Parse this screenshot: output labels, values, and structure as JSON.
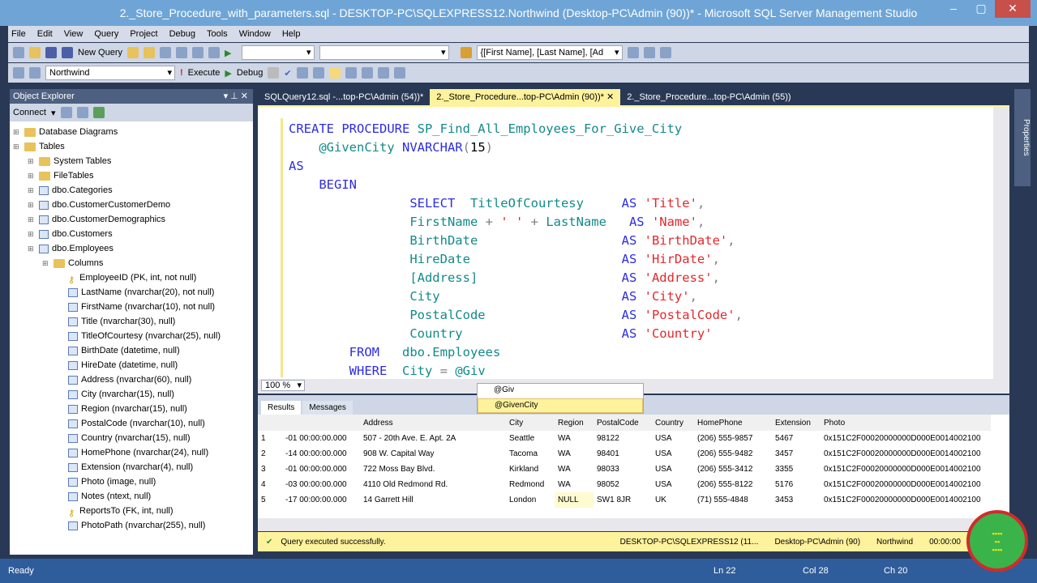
{
  "title": "2._Store_Procedure_with_parameters.sql - DESKTOP-PC\\SQLEXPRESS12.Northwind (Desktop-PC\\Admin (90))* - Microsoft SQL Server Management Studio",
  "menu": [
    "File",
    "Edit",
    "View",
    "Query",
    "Project",
    "Debug",
    "Tools",
    "Window",
    "Help"
  ],
  "toolbar": {
    "new_query": "New Query",
    "database": "Northwind",
    "execute": "Execute",
    "debug": "Debug",
    "template_combo": "{[First Name], [Last Name], [Ad"
  },
  "object_explorer": {
    "title": "Object Explorer",
    "connect": "Connect",
    "items": [
      {
        "label": "Database Diagrams",
        "level": 0,
        "icon": "folder"
      },
      {
        "label": "Tables",
        "level": 0,
        "icon": "folder"
      },
      {
        "label": "System Tables",
        "level": 1,
        "icon": "folder"
      },
      {
        "label": "FileTables",
        "level": 1,
        "icon": "folder"
      },
      {
        "label": "dbo.Categories",
        "level": 1,
        "icon": "table"
      },
      {
        "label": "dbo.CustomerCustomerDemo",
        "level": 1,
        "icon": "table"
      },
      {
        "label": "dbo.CustomerDemographics",
        "level": 1,
        "icon": "table"
      },
      {
        "label": "dbo.Customers",
        "level": 1,
        "icon": "table"
      },
      {
        "label": "dbo.Employees",
        "level": 1,
        "icon": "table"
      },
      {
        "label": "Columns",
        "level": 2,
        "icon": "folder"
      },
      {
        "label": "EmployeeID (PK, int, not null)",
        "level": 3,
        "icon": "key"
      },
      {
        "label": "LastName (nvarchar(20), not null)",
        "level": 3,
        "icon": "column"
      },
      {
        "label": "FirstName (nvarchar(10), not null)",
        "level": 3,
        "icon": "column"
      },
      {
        "label": "Title (nvarchar(30), null)",
        "level": 3,
        "icon": "column"
      },
      {
        "label": "TitleOfCourtesy (nvarchar(25), null)",
        "level": 3,
        "icon": "column"
      },
      {
        "label": "BirthDate (datetime, null)",
        "level": 3,
        "icon": "column"
      },
      {
        "label": "HireDate (datetime, null)",
        "level": 3,
        "icon": "column"
      },
      {
        "label": "Address (nvarchar(60), null)",
        "level": 3,
        "icon": "column"
      },
      {
        "label": "City (nvarchar(15), null)",
        "level": 3,
        "icon": "column"
      },
      {
        "label": "Region (nvarchar(15), null)",
        "level": 3,
        "icon": "column"
      },
      {
        "label": "PostalCode (nvarchar(10), null)",
        "level": 3,
        "icon": "column"
      },
      {
        "label": "Country (nvarchar(15), null)",
        "level": 3,
        "icon": "column"
      },
      {
        "label": "HomePhone (nvarchar(24), null)",
        "level": 3,
        "icon": "column"
      },
      {
        "label": "Extension (nvarchar(4), null)",
        "level": 3,
        "icon": "column"
      },
      {
        "label": "Photo (image, null)",
        "level": 3,
        "icon": "column"
      },
      {
        "label": "Notes (ntext, null)",
        "level": 3,
        "icon": "column"
      },
      {
        "label": "ReportsTo (FK, int, null)",
        "level": 3,
        "icon": "key"
      },
      {
        "label": "PhotoPath (nvarchar(255), null)",
        "level": 3,
        "icon": "column"
      }
    ]
  },
  "tabs": [
    {
      "label": "SQLQuery12.sql -...top-PC\\Admin (54))*",
      "active": false
    },
    {
      "label": "2._Store_Procedure...top-PC\\Admin (90))*",
      "active": true
    },
    {
      "label": "2._Store_Procedure...top-PC\\Admin (55))",
      "active": false
    }
  ],
  "code": [
    [
      [
        "kw",
        "CREATE PROCEDURE "
      ],
      [
        "fn",
        "SP_Find_All_Employees_For_Give_City"
      ]
    ],
    [
      [
        "",
        "    "
      ],
      [
        "id",
        "@GivenCity "
      ],
      [
        "kw",
        "NVARCHAR"
      ],
      [
        "gr",
        "("
      ],
      [
        "",
        "15"
      ],
      [
        "gr",
        ")"
      ]
    ],
    [
      [
        "kw",
        "AS"
      ]
    ],
    [
      [
        "kw",
        "    BEGIN"
      ]
    ],
    [
      [
        "",
        "                "
      ],
      [
        "kw",
        "SELECT  "
      ],
      [
        "id",
        "TitleOfCourtesy     "
      ],
      [
        "kw",
        "AS "
      ],
      [
        "str",
        "'Title'"
      ],
      [
        "gr",
        ","
      ]
    ],
    [
      [
        "",
        "                "
      ],
      [
        "id",
        "FirstName "
      ],
      [
        "gr",
        "+ "
      ],
      [
        "str",
        "' ' "
      ],
      [
        "gr",
        "+ "
      ],
      [
        "id",
        "LastName   "
      ],
      [
        "kw",
        "AS "
      ],
      [
        "str",
        "'Name'"
      ],
      [
        "gr",
        ","
      ]
    ],
    [
      [
        "",
        "                "
      ],
      [
        "id",
        "BirthDate                   "
      ],
      [
        "kw",
        "AS "
      ],
      [
        "str",
        "'BirthDate'"
      ],
      [
        "gr",
        ","
      ]
    ],
    [
      [
        "",
        "                "
      ],
      [
        "id",
        "HireDate                    "
      ],
      [
        "kw",
        "AS "
      ],
      [
        "str",
        "'HirDate'"
      ],
      [
        "gr",
        ","
      ]
    ],
    [
      [
        "",
        "                "
      ],
      [
        "id",
        "[Address]                   "
      ],
      [
        "kw",
        "AS "
      ],
      [
        "str",
        "'Address'"
      ],
      [
        "gr",
        ","
      ]
    ],
    [
      [
        "",
        "                "
      ],
      [
        "id",
        "City                        "
      ],
      [
        "kw",
        "AS "
      ],
      [
        "str",
        "'City'"
      ],
      [
        "gr",
        ","
      ]
    ],
    [
      [
        "",
        "                "
      ],
      [
        "id",
        "PostalCode                  "
      ],
      [
        "kw",
        "AS "
      ],
      [
        "str",
        "'PostalCode'"
      ],
      [
        "gr",
        ","
      ]
    ],
    [
      [
        "",
        "                "
      ],
      [
        "id",
        "Country                     "
      ],
      [
        "kw",
        "AS "
      ],
      [
        "str",
        "'Country'"
      ]
    ],
    [
      [
        "",
        "        "
      ],
      [
        "kw",
        "FROM   "
      ],
      [
        "id",
        "dbo.Employees"
      ]
    ],
    [
      [
        "",
        "        "
      ],
      [
        "kw",
        "WHERE  "
      ],
      [
        "id",
        "City "
      ],
      [
        "gr",
        "= "
      ],
      [
        "id",
        "@Giv"
      ]
    ]
  ],
  "zoom": "100 %",
  "autocomplete": [
    "@Giv",
    "@GivenCity"
  ],
  "results_tabs": {
    "results": "Results",
    "messages": "Messages"
  },
  "grid": {
    "columns": [
      "",
      "",
      "Address",
      "City",
      "Region",
      "PostalCode",
      "Country",
      "HomePhone",
      "Extension",
      "Photo"
    ],
    "rows": [
      [
        "1",
        "-01 00:00:00.000",
        "507 - 20th Ave. E. Apt. 2A",
        "Seattle",
        "WA",
        "98122",
        "USA",
        "(206) 555-9857",
        "5467",
        "0x151C2F00020000000D000E0014002100"
      ],
      [
        "2",
        "-14 00:00:00.000",
        "908 W. Capital Way",
        "Tacoma",
        "WA",
        "98401",
        "USA",
        "(206) 555-9482",
        "3457",
        "0x151C2F00020000000D000E0014002100"
      ],
      [
        "3",
        "-01 00:00:00.000",
        "722 Moss Bay Blvd.",
        "Kirkland",
        "WA",
        "98033",
        "USA",
        "(206) 555-3412",
        "3355",
        "0x151C2F00020000000D000E0014002100"
      ],
      [
        "4",
        "-03 00:00:00.000",
        "4110 Old Redmond Rd.",
        "Redmond",
        "WA",
        "98052",
        "USA",
        "(206) 555-8122",
        "5176",
        "0x151C2F00020000000D000E0014002100"
      ],
      [
        "5",
        "-17 00:00:00.000",
        "14 Garrett Hill",
        "London",
        "NULL",
        "SW1 8JR",
        "UK",
        "(71) 555-4848",
        "3453",
        "0x151C2F00020000000D000E0014002100"
      ]
    ]
  },
  "status": {
    "message": "Query executed successfully.",
    "server": "DESKTOP-PC\\SQLEXPRESS12 (11...",
    "user": "Desktop-PC\\Admin (90)",
    "db": "Northwind",
    "time": "00:00:00"
  },
  "bottom": {
    "ready": "Ready",
    "ln": "Ln 22",
    "col": "Col 28",
    "ch": "Ch 20"
  },
  "properties_label": "Properties",
  "colors": {
    "accent": "#fff29d",
    "chrome": "#293955",
    "keyword": "#2d2de0",
    "string": "#e0292d"
  }
}
